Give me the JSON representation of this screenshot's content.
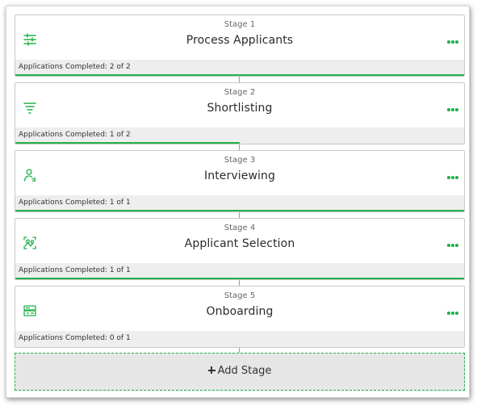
{
  "colors": {
    "accent": "#22b14c",
    "footer_bg": "#eeeeee",
    "add_bg": "#e6e6e6"
  },
  "stages": [
    {
      "number_label": "Stage 1",
      "title": "Process Applicants",
      "icon": "sliders-icon",
      "completed_label": "Applications Completed: 2 of 2",
      "completed": 2,
      "total": 2
    },
    {
      "number_label": "Stage 2",
      "title": "Shortlisting",
      "icon": "filter-icon",
      "completed_label": "Applications Completed: 1 of 2",
      "completed": 1,
      "total": 2
    },
    {
      "number_label": "Stage 3",
      "title": "Interviewing",
      "icon": "user-interview-icon",
      "completed_label": "Applications Completed: 1 of 1",
      "completed": 1,
      "total": 1
    },
    {
      "number_label": "Stage 4",
      "title": "Applicant Selection",
      "icon": "user-select-icon",
      "completed_label": "Applications Completed: 1 of 1",
      "completed": 1,
      "total": 1
    },
    {
      "number_label": "Stage 5",
      "title": "Onboarding",
      "icon": "id-card-icon",
      "completed_label": "Applications Completed: 0 of 1",
      "completed": 0,
      "total": 1
    }
  ],
  "add_stage": {
    "label": "Add Stage",
    "icon": "plus-icon"
  }
}
